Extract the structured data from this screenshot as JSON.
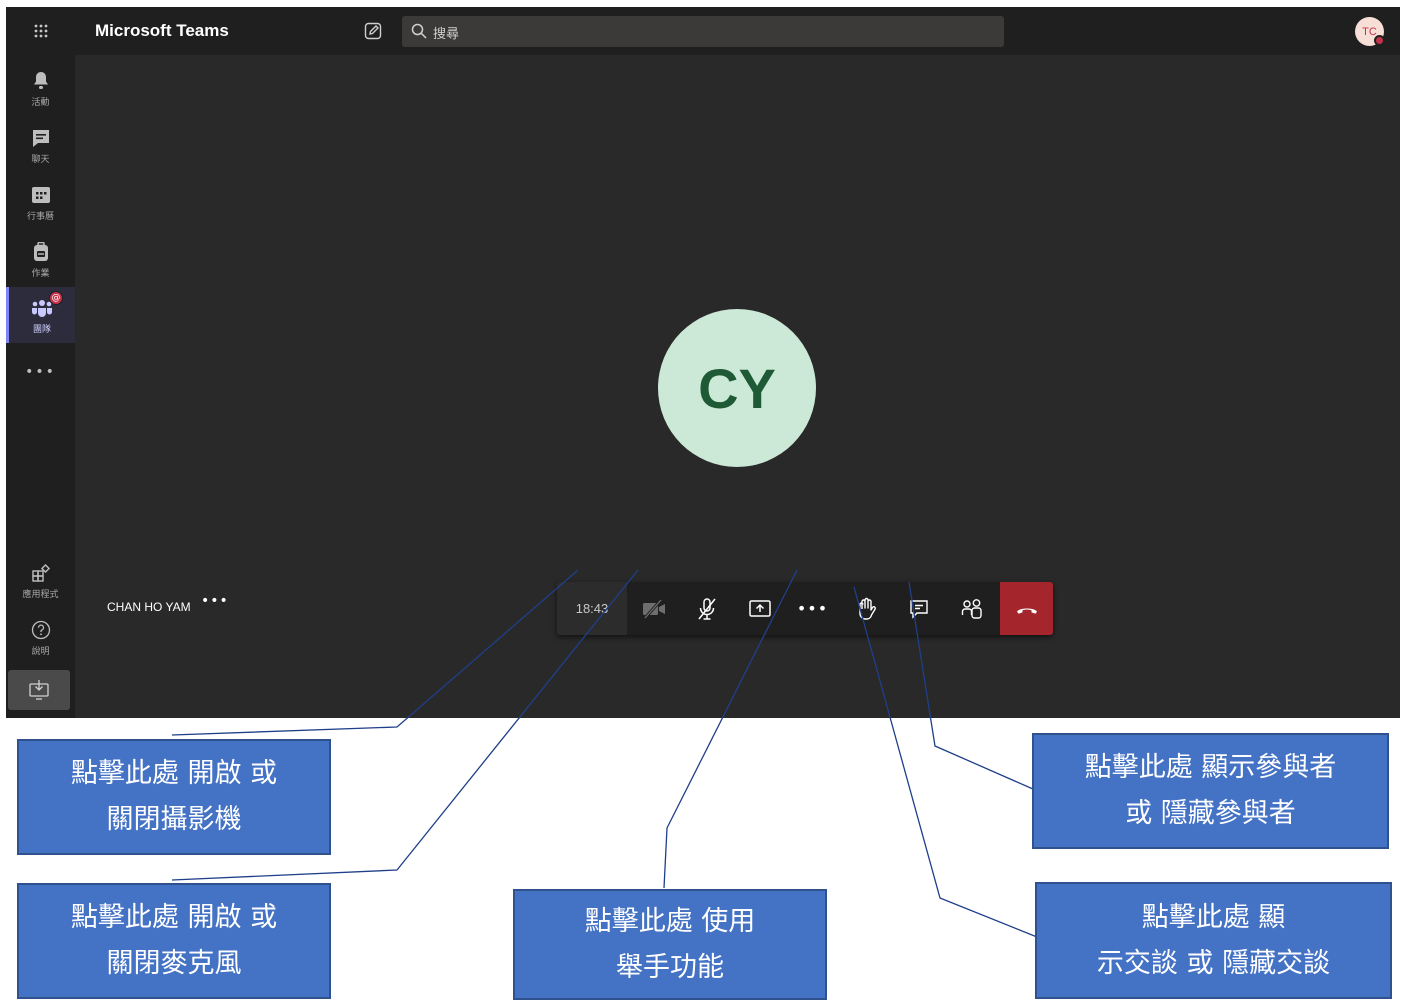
{
  "app": {
    "title": "Microsoft Teams"
  },
  "search": {
    "placeholder": "搜尋"
  },
  "user": {
    "initials": "TC"
  },
  "rail": {
    "items": [
      {
        "label": "活動"
      },
      {
        "label": "聊天"
      },
      {
        "label": "行事曆"
      },
      {
        "label": "作業"
      },
      {
        "label": "團隊",
        "badge": "@"
      }
    ],
    "more": "•••",
    "apps_label": "應用程式",
    "help_label": "說明"
  },
  "meeting": {
    "participant_initials": "CY",
    "participant_name": "CHAN HO YAM",
    "participant_more": "•••",
    "timer": "18:43",
    "more_actions": "•••"
  },
  "annotations": {
    "camera": {
      "line1": "點擊此處 開啟 或",
      "line2": "關閉攝影機"
    },
    "mic": {
      "line1": "點擊此處 開啟 或",
      "line2": "關閉麥克風"
    },
    "raise_hand": {
      "line1": "點擊此處 使用",
      "line2": "舉手功能"
    },
    "participants": {
      "line1": "點擊此處 顯示參與者",
      "line2": "或 隱藏參與者"
    },
    "chat": {
      "line1": "點擊此處 顯",
      "line2": "示交談 或 隱藏交談"
    }
  },
  "colors": {
    "app_bg": "#292929",
    "rail_bg": "#1f1f1f",
    "accent": "#7f85f5",
    "hangup": "#a4262c",
    "avatar_bg": "#cce8d6",
    "annotation_fill": "#4472c4",
    "annotation_border": "#2f528f",
    "leader_line": "#1f3f8a"
  }
}
